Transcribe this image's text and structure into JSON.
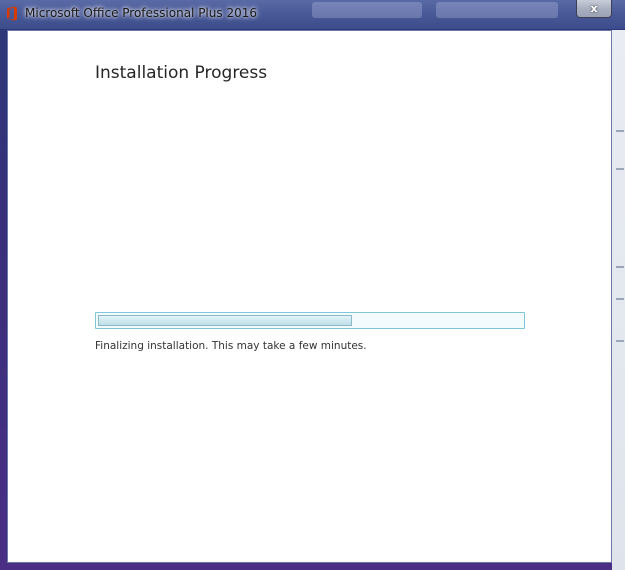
{
  "window": {
    "title": "Microsoft Office Professional Plus 2016",
    "close_label": "x",
    "accent_color": "#d83b01"
  },
  "content": {
    "heading": "Installation Progress",
    "status": "Finalizing installation. This may take a few minutes.",
    "progress": 0.6
  },
  "icons": {
    "app": "office-icon",
    "close": "close-icon"
  }
}
